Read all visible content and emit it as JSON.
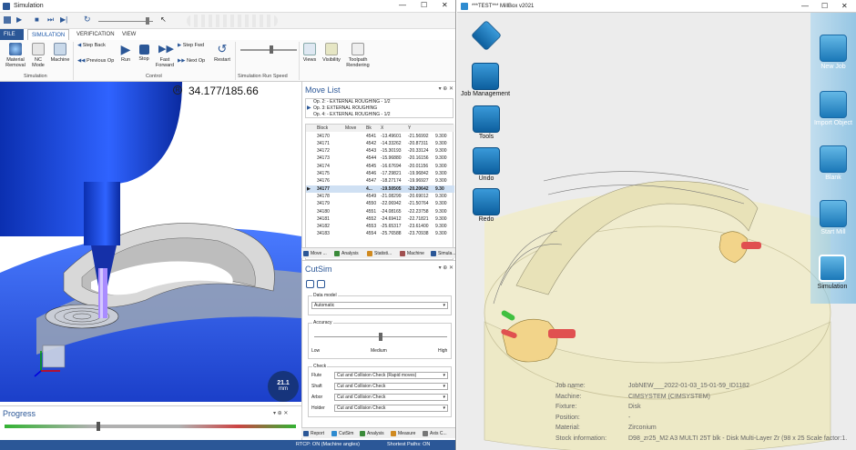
{
  "left_window": {
    "title": "Simulation",
    "ribbon_tabs": [
      "FILE",
      "SIMULATION",
      "VERIFICATION",
      "VIEW"
    ],
    "groups": {
      "simulation": {
        "label": "Simulation",
        "buttons": [
          "Material Removal",
          "NC Mode",
          "Machine"
        ]
      },
      "control": {
        "label": "Control",
        "buttons": {
          "step_back": "Step Back",
          "previous_op": "Previous Op",
          "run": "Run",
          "stop": "Stop",
          "fast_forward": "Fast Forward",
          "step_fwd": "Step Fwd",
          "next_op": "Next Op",
          "restart": "Restart"
        }
      },
      "run_speed": {
        "label": "Simulation Run Speed"
      },
      "view": {
        "buttons": [
          "Views",
          "Visibility",
          "Toolpath Rendering"
        ]
      }
    },
    "viewport": {
      "overlay_text": "34.177/185.66",
      "overlay_icon": "compass-icon",
      "gauge_value": "21.1",
      "gauge_unit": "mm"
    },
    "progress": {
      "title": "Progress"
    },
    "status": {
      "rtcp": "RTCP: ON (Machine angles)",
      "shortest": "Shortest Paths: ON"
    }
  },
  "move_list": {
    "title": "Move List",
    "ops": [
      "Op. 2: - EXTERNAL ROUGHING - 1/2",
      "Op. 3: EXTERNAL ROUGHING",
      "Op. 4: - EXTERNAL ROUGHING - 1/2"
    ],
    "columns": [
      "Block",
      "Move",
      "Bk",
      "X",
      "Y",
      ""
    ],
    "rows": [
      [
        "34170",
        "",
        "4541",
        "-13.49601",
        "-21.56992",
        "9.300"
      ],
      [
        "34171",
        "",
        "4542",
        "-14.33262",
        "-20.87311",
        "9.300"
      ],
      [
        "34172",
        "",
        "4543",
        "-15.30193",
        "-20.33124",
        "9.300"
      ],
      [
        "34173",
        "",
        "4544",
        "-15.96880",
        "-20.16156",
        "9.300"
      ],
      [
        "34174",
        "",
        "4545",
        "-16.67694",
        "-20.01156",
        "9.300"
      ],
      [
        "34175",
        "",
        "4546",
        "-17.29821",
        "-19.96842",
        "9.300"
      ],
      [
        "34176",
        "",
        "4547",
        "-18.27174",
        "-19.96927",
        "9.300"
      ],
      [
        "34177",
        "",
        "4...",
        "-19.50505",
        "-20.20642",
        "9.30"
      ],
      [
        "34178",
        "",
        "4549",
        "-21.08299",
        "-20.69012",
        "9.300"
      ],
      [
        "34179",
        "",
        "4550",
        "-22.06942",
        "-21.50764",
        "9.300"
      ],
      [
        "34180",
        "",
        "4551",
        "-24.08165",
        "-22.23758",
        "9.300"
      ],
      [
        "34181",
        "",
        "4552",
        "-24.69412",
        "-22.71821",
        "9.300"
      ],
      [
        "34182",
        "",
        "4553",
        "-25.65317",
        "-23.61400",
        "9.300"
      ],
      [
        "34183",
        "",
        "4554",
        "-25.76588",
        "-23.70938",
        "9.300"
      ]
    ],
    "selected_index": 7,
    "bottom_tabs": [
      "Move ...",
      "Analysis",
      "Statisti...",
      "Machine",
      "Simula..."
    ]
  },
  "cutsim": {
    "title": "CutSim",
    "data_model_label": "Data model",
    "data_model_value": "Automatic",
    "accuracy_label": "Accuracy",
    "accuracy_ticks": [
      "Low",
      "Medium",
      "High"
    ],
    "accuracy_level": 0.5,
    "check_label": "Check",
    "checks": [
      {
        "label": "Flute",
        "value": "Cut and Collision Check (Rapid moves)"
      },
      {
        "label": "Shaft",
        "value": "Cut and Collision Check"
      },
      {
        "label": "Arbor",
        "value": "Cut and Collision Check"
      },
      {
        "label": "Holder",
        "value": "Cut and Collision Check"
      }
    ],
    "bottom_tabs": [
      "Report",
      "CutSim",
      "Analysis",
      "Measure",
      "Axis C..."
    ]
  },
  "right_window": {
    "title": "***TEST*** MillBox v2021",
    "left_buttons": [
      {
        "label": "",
        "icon": "home-icon"
      },
      {
        "label": "Job Management",
        "icon": "job-management-icon"
      },
      {
        "label": "Tools",
        "icon": "tools-icon"
      },
      {
        "label": "Undo",
        "icon": "undo-icon"
      },
      {
        "label": "Redo",
        "icon": "redo-icon"
      }
    ],
    "right_buttons": [
      {
        "label": "New Job",
        "icon": "new-job-icon"
      },
      {
        "label": "Import Object",
        "icon": "import-object-icon"
      },
      {
        "label": "Blank",
        "icon": "blank-icon"
      },
      {
        "label": "Start Mill",
        "icon": "start-mill-icon"
      },
      {
        "label": "Simulation",
        "icon": "simulation-icon"
      }
    ],
    "info": [
      {
        "key": "Job name:",
        "value": "JobNEW___2022-01-03_15-01-59_ID1182"
      },
      {
        "key": "Machine:",
        "value": "CIMSYSTEM (CIMSYSTEM)"
      },
      {
        "key": "Fixture:",
        "value": "Disk"
      },
      {
        "key": "Position:",
        "value": "-"
      },
      {
        "key": "Material:",
        "value": "Zirconium"
      },
      {
        "key": "Stock information:",
        "value": "D98_zr25_M2 A3 MULTI 25T blk - Disk Multi-Layer Zr (98 x 25 Scale factor:1."
      }
    ]
  },
  "colors": {
    "accent": "#2b5797",
    "stock_blue": "#1f4fd8",
    "panel_blue": "#1b78b8"
  }
}
